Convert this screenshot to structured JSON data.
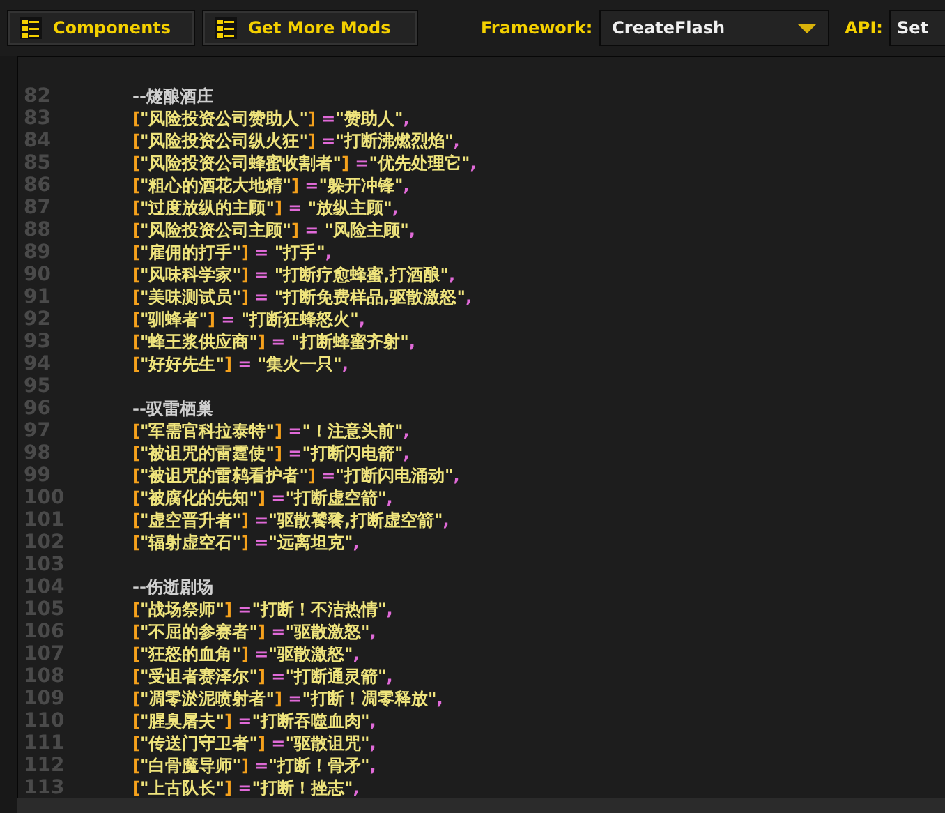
{
  "toolbar": {
    "buttons": [
      {
        "label": "Components"
      },
      {
        "label": "Get More Mods"
      }
    ],
    "framework": {
      "label": "Framework:",
      "value": "CreateFlash"
    },
    "api": {
      "label": "API:",
      "value": "Set"
    }
  },
  "editor": {
    "lines": [
      {
        "num": "82",
        "kind": "comment",
        "text": "--燧酿酒庄"
      },
      {
        "num": "83",
        "kind": "entry",
        "key": "\"风险投资公司赞助人\"",
        "op": " =",
        "value": "\"赞助人\""
      },
      {
        "num": "84",
        "kind": "entry",
        "key": "\"风险投资公司纵火狂\"",
        "op": " =",
        "value": "\"打断沸燃烈焰\""
      },
      {
        "num": "85",
        "kind": "entry",
        "key": "\"风险投资公司蜂蜜收割者\"",
        "op": " =",
        "value": "\"优先处理它\""
      },
      {
        "num": "86",
        "kind": "entry",
        "key": "\"粗心的酒花大地精\"",
        "op": " =",
        "value": "\"躲开冲锋\""
      },
      {
        "num": "87",
        "kind": "entry",
        "key": "\"过度放纵的主顾\"",
        "op": " = ",
        "value": "\"放纵主顾\""
      },
      {
        "num": "88",
        "kind": "entry",
        "key": "\"风险投资公司主顾\"",
        "op": " = ",
        "value": "\"风险主顾\""
      },
      {
        "num": "89",
        "kind": "entry",
        "key": "\"雇佣的打手\"",
        "op": " = ",
        "value": "\"打手\""
      },
      {
        "num": "90",
        "kind": "entry",
        "key": "\"风味科学家\"",
        "op": " = ",
        "value": "\"打断疗愈蜂蜜,打酒酿\""
      },
      {
        "num": "91",
        "kind": "entry",
        "key": "\"美味测试员\"",
        "op": " = ",
        "value": "\"打断免费样品,驱散激怒\""
      },
      {
        "num": "92",
        "kind": "entry",
        "key": "\"驯蜂者\"",
        "op": " = ",
        "value": "\"打断狂蜂怒火\""
      },
      {
        "num": "93",
        "kind": "entry",
        "key": "\"蜂王浆供应商\"",
        "op": " = ",
        "value": "\"打断蜂蜜齐射\""
      },
      {
        "num": "94",
        "kind": "entry",
        "key": "\"好好先生\"",
        "op": " = ",
        "value": "\"集火一只\""
      },
      {
        "num": "95",
        "kind": "blank"
      },
      {
        "num": "96",
        "kind": "comment",
        "text": "--驭雷栖巢"
      },
      {
        "num": "97",
        "kind": "entry",
        "key": "\"军需官科拉泰特\"",
        "op": " =",
        "value": "\"！注意头前\""
      },
      {
        "num": "98",
        "kind": "entry",
        "key": "\"被诅咒的雷霆使\"",
        "op": " =",
        "value": "\"打断闪电箭\""
      },
      {
        "num": "99",
        "kind": "entry",
        "key": "\"被诅咒的雷鸫看护者\"",
        "op": " =",
        "value": "\"打断闪电涌动\""
      },
      {
        "num": "100",
        "kind": "entry",
        "key": "\"被腐化的先知\"",
        "op": " =",
        "value": "\"打断虚空箭\""
      },
      {
        "num": "101",
        "kind": "entry",
        "key": "\"虚空晋升者\"",
        "op": " =",
        "value": "\"驱散饕餮,打断虚空箭\""
      },
      {
        "num": "102",
        "kind": "entry",
        "key": "\"辐射虚空石\"",
        "op": " =",
        "value": "\"远离坦克\""
      },
      {
        "num": "103",
        "kind": "blank"
      },
      {
        "num": "104",
        "kind": "comment",
        "text": "--伤逝剧场"
      },
      {
        "num": "105",
        "kind": "entry",
        "key": "\"战场祭师\"",
        "op": " =",
        "value": "\"打断！不洁热情\""
      },
      {
        "num": "106",
        "kind": "entry",
        "key": "\"不屈的参赛者\"",
        "op": " =",
        "value": "\"驱散激怒\""
      },
      {
        "num": "107",
        "kind": "entry",
        "key": "\"狂怒的血角\"",
        "op": " =",
        "value": "\"驱散激怒\""
      },
      {
        "num": "108",
        "kind": "entry",
        "key": "\"受诅者赛泽尔\"",
        "op": " =",
        "value": "\"打断通灵箭\""
      },
      {
        "num": "109",
        "kind": "entry",
        "key": "\"凋零淤泥喷射者\"",
        "op": " =",
        "value": "\"打断！凋零释放\""
      },
      {
        "num": "110",
        "kind": "entry",
        "key": "\"腥臭屠夫\"",
        "op": " =",
        "value": "\"打断吞噬血肉\""
      },
      {
        "num": "111",
        "kind": "entry",
        "key": "\"传送门守卫者\"",
        "op": " =",
        "value": "\"驱散诅咒\""
      },
      {
        "num": "112",
        "kind": "entry",
        "key": "\"白骨魔导师\"",
        "op": " =",
        "value": "\"打断！骨矛\""
      },
      {
        "num": "113",
        "kind": "entry",
        "key": "\"上古队长\"",
        "op": " =",
        "value": "\"打断！挫志\""
      }
    ],
    "open": "[",
    "close": "]",
    "end": ","
  }
}
